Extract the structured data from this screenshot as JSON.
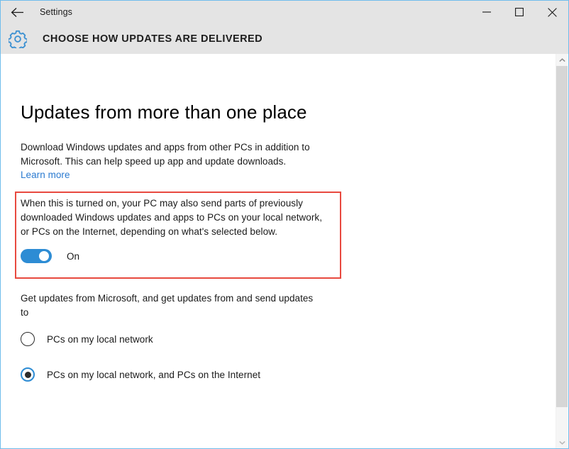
{
  "window": {
    "app_title": "Settings",
    "back_icon": "back-arrow-icon",
    "border_color": "#70bdec",
    "titlebar_color": "#e4e4e4",
    "caption_buttons": [
      {
        "name": "minimize",
        "glyph": "minimize-icon"
      },
      {
        "name": "maximize",
        "glyph": "maximize-icon"
      },
      {
        "name": "close",
        "glyph": "close-icon"
      }
    ]
  },
  "header": {
    "icon": "gear-icon",
    "title": "CHOOSE HOW UPDATES ARE DELIVERED",
    "accent_color": "#2d8cd4"
  },
  "main": {
    "heading": "Updates from more than one place",
    "intro_paragraph": "Download Windows updates and apps from other PCs in addition to Microsoft. This can help speed up app and update downloads.",
    "learn_more_label": "Learn more",
    "learn_more_color": "#2a7ad0",
    "highlight": {
      "border_color": "#e8493f",
      "description": "When this is turned on, your PC may also send parts of previously downloaded Windows updates and apps to PCs on your local network, or PCs on the Internet, depending on what's selected below.",
      "toggle": {
        "state_label": "On",
        "checked": true,
        "on_color": "#2d8cd4",
        "knob_color": "#ffffff"
      }
    },
    "radio_intro": "Get updates from Microsoft, and get updates from and send updates to",
    "radio_options": [
      {
        "label": "PCs on my local network",
        "selected": false
      },
      {
        "label": "PCs on my local network, and PCs on the Internet",
        "selected": true
      }
    ],
    "radio_selected_color": "#2d8cd4"
  },
  "scrollbar": {
    "up_arrow_icon": "chevron-up-icon",
    "down_arrow_icon": "chevron-down-icon",
    "thumb_color": "#d6d6d6",
    "track_color": "#f5f5f5"
  }
}
